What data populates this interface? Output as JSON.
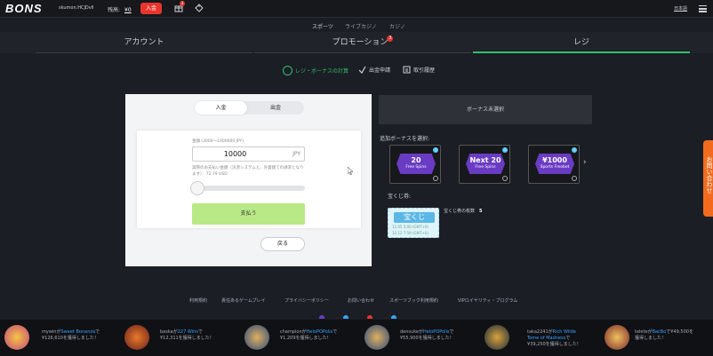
{
  "header": {
    "logo": "BONS",
    "username": "skumon.HCJDvll",
    "balance_label": "残高:",
    "balance_value": "¥0",
    "deposit_label": "入金",
    "gift_badge": "3",
    "language": "日本語"
  },
  "categories": [
    "スポーツ",
    "ライブカジノ",
    "カジノ"
  ],
  "tabs": [
    {
      "label": "アカウント"
    },
    {
      "label": "プロモーション",
      "badge": "3"
    },
    {
      "label": "レジ"
    }
  ],
  "subnav": [
    {
      "label": "レジ・ボーナスの計算"
    },
    {
      "label": "出金申請"
    },
    {
      "label": "取引履歴"
    }
  ],
  "cashier": {
    "segment_deposit": "入金",
    "segment_withdraw": "出金",
    "amount_label": "金額 (3000～1000000 JPY)",
    "amount_value": "10000",
    "currency": "JPY",
    "conversion_note": "実際のお支払い金額（決済システムと、外貨建ての請求となります）：72.79 USD",
    "slider_value": 0,
    "pay_button": "支払う",
    "back_button": "戻る"
  },
  "bonus": {
    "none_selected": "ボーナス未選択",
    "add_title": "追加ボーナスを選択:",
    "cards": [
      {
        "main": "20",
        "sub": "Free Spins"
      },
      {
        "main": "Next 20",
        "sub": "Free Spins"
      },
      {
        "main": "¥1000",
        "sub": "Sports Freebet"
      }
    ]
  },
  "lottery": {
    "title": "宝くじ券:",
    "ticket_label": "宝くじ",
    "ticket_date1": "12.05 5:00 (GMT+0)",
    "ticket_date2": "12.12 7:59 (GMT+0)",
    "count_label": "宝くじ券の枚数",
    "count_value": "5"
  },
  "side_tab": "お問い合わせ",
  "footer_links": [
    "利用規約",
    "責任あるゲームプレイ",
    "プライバシーポリシー",
    "お問い合わせ",
    "スポーツブック利用規約",
    "VIPロイヤリティ・プログラム"
  ],
  "winners": [
    {
      "user": "mywin",
      "game": "Sweet Bonanza",
      "rest": "で¥126,610を獲得しました！"
    },
    {
      "user": "baska",
      "game": "227 Wins",
      "rest": "で¥12,311を獲得しました！"
    },
    {
      "user": "champion",
      "game": "HeloPOPolis",
      "rest": "で¥1,209を獲得しました！"
    },
    {
      "user": "densuke",
      "game": "HeloPOPolis",
      "rest": "で¥55,900を獲得しました！"
    },
    {
      "user": "taka2241",
      "game": "Rich Wilde Tome of Madness",
      "rest": "で¥39,250を獲得しました！"
    },
    {
      "user": "telete",
      "game": "BacBo",
      "rest": "で¥49,500を獲得しました！"
    }
  ],
  "colors": {
    "accent_green": "#2fbf71",
    "accent_red": "#e8352c",
    "accent_blue": "#3aa2ff",
    "bonus_purple": "#6a3cc4",
    "side_orange": "#f26b1d"
  }
}
